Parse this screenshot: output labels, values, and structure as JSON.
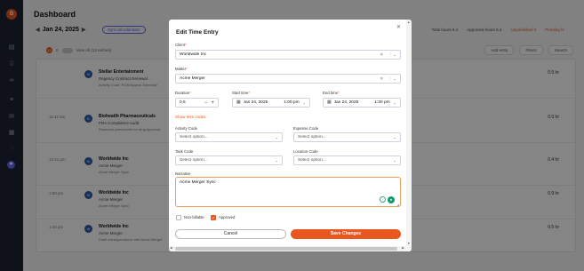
{
  "app": {
    "logo_letter": "B",
    "page_title": "Dashboard"
  },
  "header": {
    "date": "Jan 24, 2025",
    "pill_button": "Sync all calendars",
    "stats": [
      {
        "label": "Total hours 5.4"
      },
      {
        "label": "Approved hours 5.4"
      },
      {
        "label": "Unpublished 0",
        "accent": true
      },
      {
        "label": "Pending hr",
        "accent": true
      }
    ]
  },
  "toolbar": {
    "badge": "12",
    "counts": "0",
    "view_all": "View All (13 entries)",
    "add_entry": "Add entry",
    "filters": "Filters",
    "search": "Search"
  },
  "entries": [
    {
      "time": "",
      "avatar": "W",
      "client": "Stellar Entertainment",
      "matter": "Regency Contract Renewal",
      "desc": "Activity Code: RGM Appeal Schedule",
      "hours": "0.5 hr"
    },
    {
      "time": "11:42 am",
      "avatar": "B",
      "client": "Bioheatlh Pharmaceuticals",
      "matter": "FDA Compliance Audit",
      "desc": "Research precedents for drug approval",
      "hours": "0.5 hr"
    },
    {
      "time": "12:41 pm",
      "avatar": "W",
      "client": "Worldwide Inc",
      "matter": "Acme Merger",
      "desc": "Acme Merger Sync",
      "hours": "0.4 hr"
    },
    {
      "time": "1:00 pm",
      "avatar": "W",
      "client": "Worldwide Inc",
      "matter": "Acme Merger",
      "desc": "Acme Merger Sync",
      "hours": "0.9 hr"
    },
    {
      "time": "1:44 pm",
      "avatar": "W",
      "client": "Worldwide Inc",
      "matter": "Acme Merger",
      "desc": "Draft correspondence with Acme Merger",
      "hours": "0.5 hr"
    }
  ],
  "modal": {
    "title": "Edit Time Entry",
    "client_label": "Client",
    "client_value": "Worldwide Inc",
    "matter_label": "Matter",
    "matter_value": "Acme Merger",
    "duration_label": "Duration",
    "duration_value": "0.5",
    "start_label": "Start time",
    "start_date": "Jan 24, 2025",
    "start_time": "1:00 pm",
    "end_label": "End time",
    "end_date": "Jan 24, 2025",
    "end_time": "1:30 pm",
    "show_less": "Show less codes",
    "activity_label": "Activity Code",
    "activity_placeholder": "Select option...",
    "expense_label": "Expense Code",
    "expense_placeholder": "Select option...",
    "task_label": "Task Code",
    "task_placeholder": "Select option...",
    "location_label": "Location Code",
    "location_placeholder": "Select option...",
    "narrative_label": "Narrative",
    "narrative_value": "Acme Merger Sync",
    "non_billable": "Non-billable",
    "approved": "Approved",
    "cancel": "Cancel",
    "save": "Save Changes"
  },
  "colors": {
    "accent": "#e8571f",
    "sidebar": "#1e2433",
    "primary_link": "#6466f1"
  }
}
